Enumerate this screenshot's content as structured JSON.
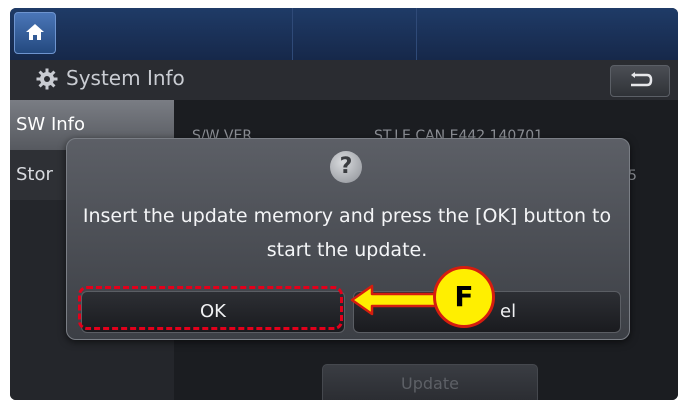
{
  "title": "System Info",
  "menu": {
    "items": [
      {
        "label": "SW Info"
      },
      {
        "label": "Stor"
      }
    ]
  },
  "content": {
    "row1_label": "S/W VER",
    "row1_value": "ST.LE.CAN.E442.140701",
    "row2_value": "5",
    "update_label": "Update"
  },
  "dialog": {
    "icon": "question-icon",
    "message": "Insert the update memory and press the [OK] button to start the update.",
    "ok_label": "OK",
    "cancel_label": "el"
  },
  "annotation": {
    "badge_label": "F",
    "highlight_color": "#e3001b",
    "arrow_color": "#ffef00"
  }
}
